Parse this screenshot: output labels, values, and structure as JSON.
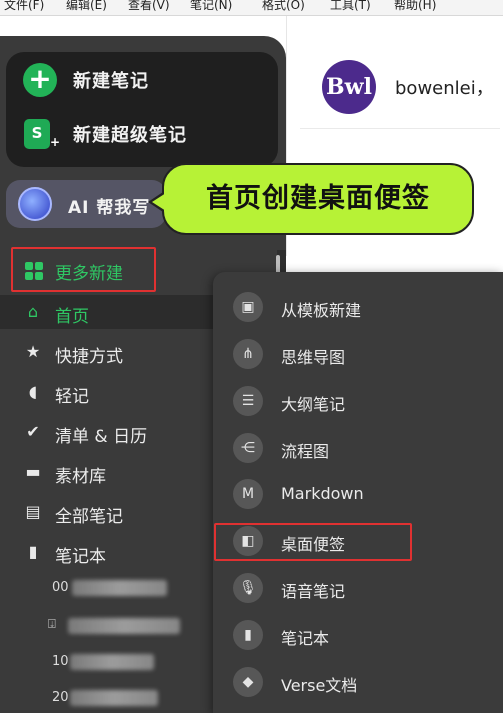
{
  "menubar": {
    "items": [
      "文件(F)",
      "编辑(E)",
      "查看(V)",
      "笔记(N)",
      "格式(O)",
      "工具(T)",
      "帮助(H)"
    ]
  },
  "create": {
    "new_note": "新建笔记",
    "new_super_note": "新建超级笔记",
    "super_note_icon_letter": "S"
  },
  "ai": {
    "label": "AI 帮我写"
  },
  "nav": {
    "items": [
      {
        "label": "更多新建",
        "icon": "grid-icon"
      },
      {
        "label": "首页",
        "icon": "home-icon"
      },
      {
        "label": "快捷方式",
        "icon": "star-icon"
      },
      {
        "label": "轻记",
        "icon": "quick-note-icon"
      },
      {
        "label": "清单 & 日历",
        "icon": "check-circle-icon"
      },
      {
        "label": "素材库",
        "icon": "material-box-icon"
      },
      {
        "label": "全部笔记",
        "icon": "document-icon"
      },
      {
        "label": "笔记本",
        "icon": "notebook-icon"
      }
    ],
    "notebooks": [
      {
        "prefix": "00"
      },
      {
        "prefix": ""
      },
      {
        "prefix": "10"
      },
      {
        "prefix": "20"
      }
    ]
  },
  "profile": {
    "avatar_text": "Bwl",
    "username": "bowenlei，"
  },
  "callout": {
    "text": "首页创建桌面便签"
  },
  "popup": {
    "items": [
      {
        "label": "从模板新建",
        "icon": "template-icon"
      },
      {
        "label": "思维导图",
        "icon": "mindmap-icon"
      },
      {
        "label": "大纲笔记",
        "icon": "outline-icon"
      },
      {
        "label": "流程图",
        "icon": "flowchart-icon"
      },
      {
        "label": "Markdown",
        "icon": "markdown-icon"
      },
      {
        "label": "桌面便签",
        "icon": "sticky-note-icon"
      },
      {
        "label": "语音笔记",
        "icon": "microphone-icon"
      },
      {
        "label": "笔记本",
        "icon": "notebook-icon"
      },
      {
        "label": "Verse文档",
        "icon": "verse-icon"
      }
    ]
  },
  "colors": {
    "accent_green": "#2fc764",
    "highlight_red": "#e03131",
    "callout_bg": "#b7f236",
    "sidebar_bg": "#3a3a3a"
  }
}
